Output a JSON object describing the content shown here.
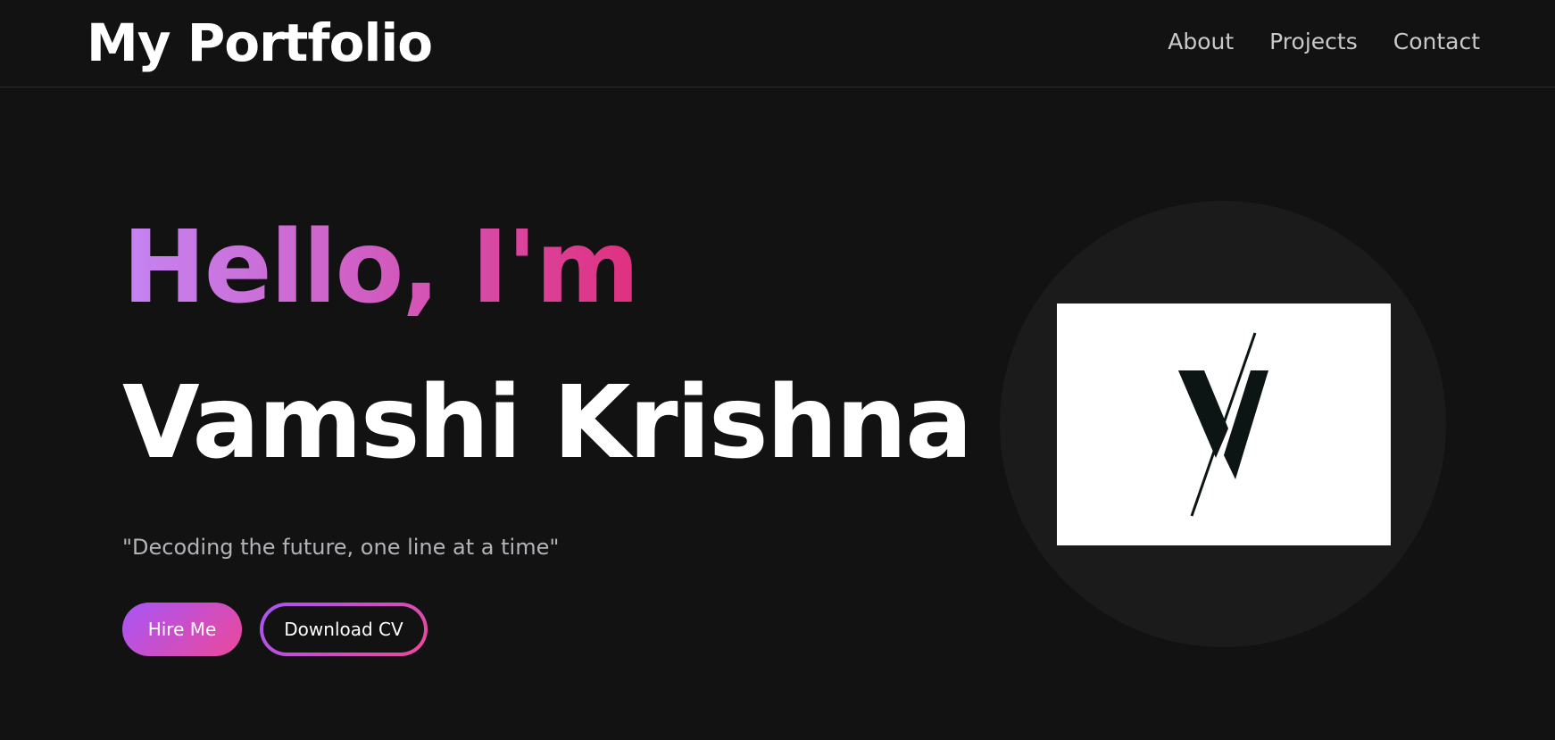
{
  "header": {
    "brand": "My Portfolio",
    "nav": [
      {
        "label": "About"
      },
      {
        "label": "Projects"
      },
      {
        "label": "Contact"
      }
    ]
  },
  "hero": {
    "greeting": "Hello, I'm",
    "name": "Vamshi Krishna",
    "tagline": "\"Decoding the future, one line at a time\"",
    "buttons": {
      "hire": "Hire Me",
      "cv": "Download CV"
    },
    "logo_icon": "vk-monogram-logo"
  },
  "colors": {
    "background": "#121212",
    "gradient_start": "#a855f7",
    "gradient_end": "#ec4899",
    "nav_text": "#c9c9c9",
    "tagline_text": "#b4b4b8"
  }
}
